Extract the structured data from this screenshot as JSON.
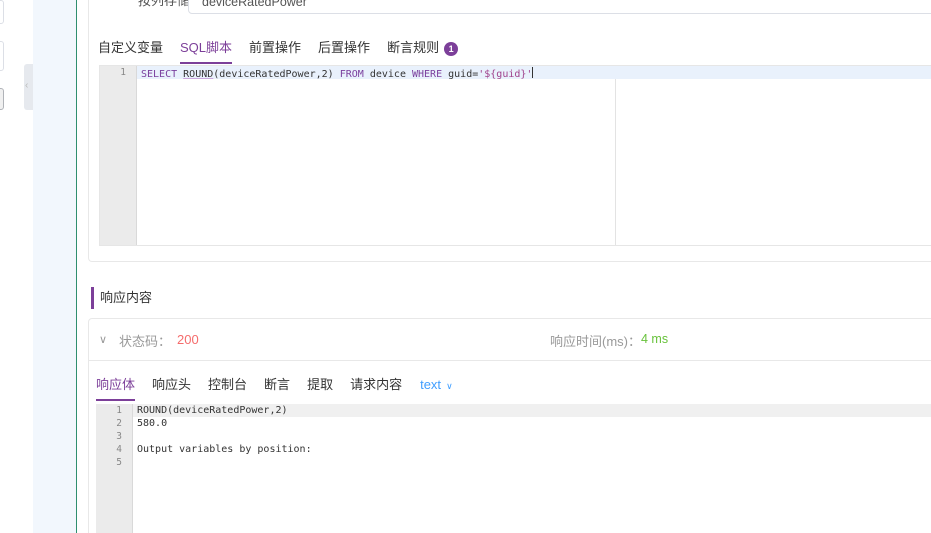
{
  "left_panel": {
    "collapse_arrow": "‹"
  },
  "storage": {
    "label": "按列存储",
    "value": "deviceRatedPower"
  },
  "script_tabs": [
    {
      "label": "自定义变量"
    },
    {
      "label": "SQL脚本"
    },
    {
      "label": "前置操作"
    },
    {
      "label": "后置操作"
    },
    {
      "label": "断言规则",
      "badge": "1"
    }
  ],
  "active_script_tab": "SQL脚本",
  "sql_editor": {
    "line_number": "1",
    "tokens": {
      "select": "SELECT",
      "round": "ROUND",
      "args": "(deviceRatedPower,2)",
      "from": "FROM",
      "table": "device",
      "where": "WHERE",
      "col": "guid=",
      "value": "'${guid}'"
    }
  },
  "response": {
    "section_title": "响应内容",
    "status_label": "状态码：",
    "status_code": "200",
    "time_label": "响应时间(ms)：",
    "time_value": "4 ms",
    "tabs": [
      {
        "label": "响应体"
      },
      {
        "label": "响应头"
      },
      {
        "label": "控制台"
      },
      {
        "label": "断言"
      },
      {
        "label": "提取"
      },
      {
        "label": "请求内容"
      }
    ],
    "active_tab": "响应体",
    "format": "text",
    "lines": [
      {
        "n": "1",
        "text": "ROUND(deviceRatedPower,2)"
      },
      {
        "n": "2",
        "text": "580.0"
      },
      {
        "n": "3",
        "text": ""
      },
      {
        "n": "4",
        "text": "Output variables by position:"
      },
      {
        "n": "5",
        "text": ""
      }
    ]
  },
  "colors": {
    "accent": "#7c3f99",
    "status": "#f56c6c",
    "time": "#67c23a",
    "link": "#409eff"
  },
  "icons": {
    "expand": "chevron-down-icon",
    "format_dropdown": "chevron-down-icon",
    "badge": "count-badge"
  }
}
